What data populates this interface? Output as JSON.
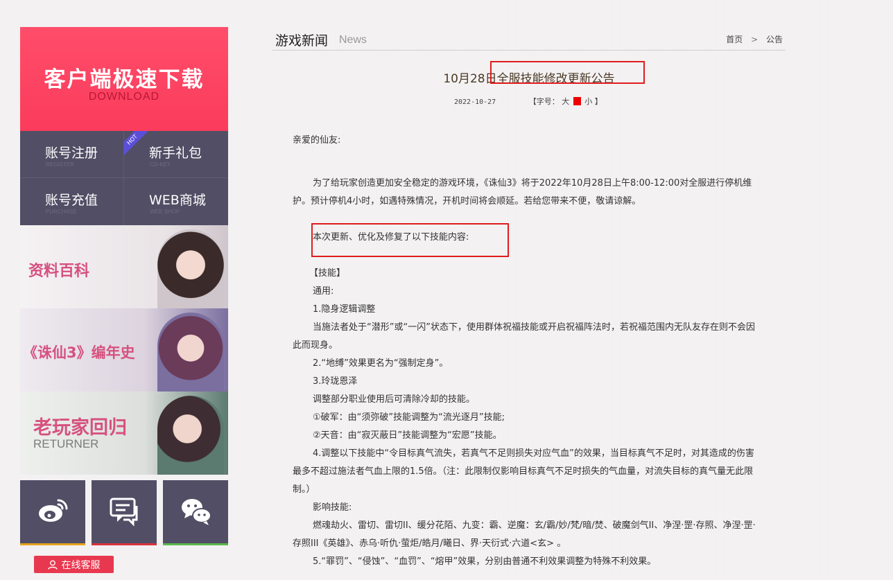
{
  "sidebar": {
    "download": {
      "title": "客户端极速下载",
      "subtitle": "DOWNLOAD"
    },
    "grid": [
      {
        "label": "账号注册",
        "sub": "REGISTER"
      },
      {
        "label": "新手礼包",
        "sub": "CD-KEY",
        "badge": "HOT"
      },
      {
        "label": "账号充值",
        "sub": "PURCHASE"
      },
      {
        "label": "WEB商城",
        "sub": "WEB SHOP"
      }
    ],
    "banners": [
      {
        "label": "资料百科",
        "sub": ""
      },
      {
        "label": "《诛仙3》编年史",
        "sub": ""
      },
      {
        "label": "老玩家回归",
        "sub": "RETURNER"
      }
    ],
    "social": [
      "weibo-icon",
      "message-icon",
      "wechat-icon"
    ],
    "service_label": "在线客服"
  },
  "header": {
    "title": "游戏新闻",
    "title_en": "News"
  },
  "breadcrumb": {
    "home": "首页",
    "sep": ">",
    "current": "公告"
  },
  "article": {
    "title": "10月28日全服技能修改更新公告",
    "date": "2022-10-27",
    "font_label": "【字号：",
    "font_big": "大",
    "font_small": "小 】",
    "greeting": "亲爱的仙友:",
    "intro": "为了给玩家创造更加安全稳定的游戏环境，《诛仙3》将于2022年10月28日上午8:00-12:00对全服进行停机维护。预计停机4小时，如遇特殊情况，开机时间将会顺延。若给您带来不便，敬请谅解。",
    "update_intro": "本次更新、优化及修复了以下技能内容:",
    "section": "【技能】",
    "lines": [
      "通用:",
      "1.隐身逻辑调整",
      "当施法者处于“潜形”或“一闪”状态下，使用群体祝福技能或开启祝福阵法时，若祝福范围内无队友存在则不会因此而现身。",
      "2.“地缚”效果更名为“强制定身”。",
      "3.玲珑恩泽",
      "调整部分职业使用后可清除冷却的技能。",
      "①破军：由“须弥破”技能调整为“流光逐月”技能;",
      "②天音：由“寂灭蔽日”技能调整为“宏愿”技能。",
      "4.调整以下技能中“令目标真气流失，若真气不足则损失对应气血”的效果，当目标真气不足时，对其造成的伤害最多不超过施法者气血上限的1.5倍。（注：此限制仅影响目标真气不足时损失的气血量，对流失目标的真气量无此限制。）",
      "影响技能:",
      "燃魂劫火、雷切、雷切II、缓分花陌、九变：霸、逆魔：玄/霸/妙/梵/暗/焚、破魔剑气II、净涅·罡·存照、净涅·罡·存照III《英雄》、赤乌·听仇·萤炬/皓月/曦日、界·天衍式·六道<玄> 。",
      "5.“罪罚”、“侵蚀”、“血罚”、“熔甲”效果，分别由普通不利效果调整为特殊不利效果。"
    ]
  },
  "colors": {
    "download_bg": "#fb3b5c",
    "panel_bg": "#514e65",
    "highlight_box": "#e01b1b",
    "service_bg": "#e8384f",
    "weibo_bar": "#e6a41e",
    "message_bar": "#d8323c",
    "wechat_bar": "#59b94a"
  }
}
